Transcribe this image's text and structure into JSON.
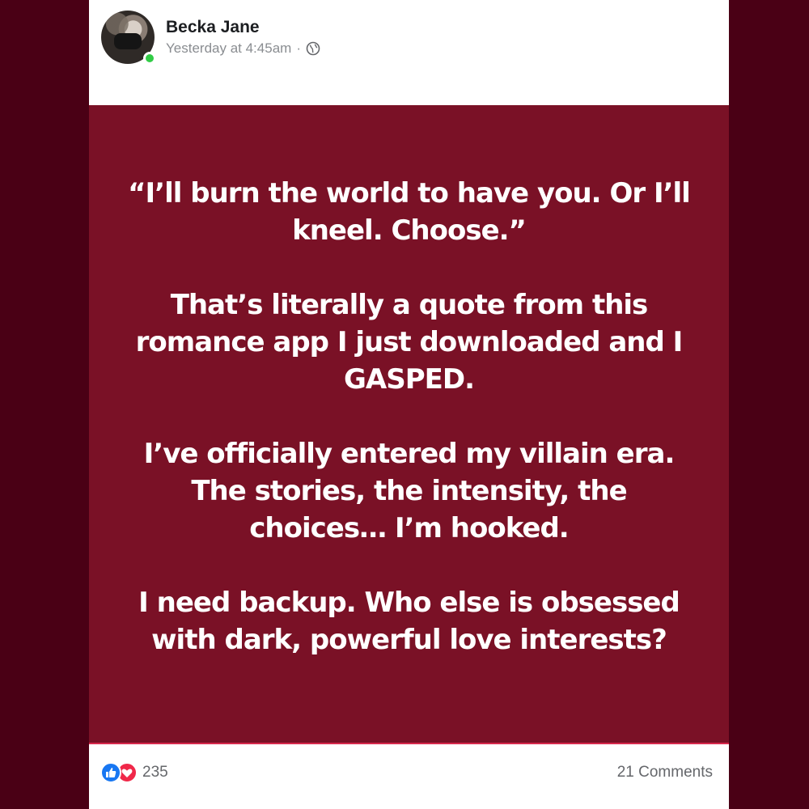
{
  "post": {
    "author": "Becka Jane",
    "timestamp": "Yesterday at 4:45am",
    "separator": "·",
    "privacy_icon": "globe-icon",
    "paragraphs": [
      "“I’ll burn the world to have you. Or I’ll kneel. Choose.”",
      "That’s literally a quote from this romance app I just downloaded and I GASPED.",
      "I’ve officially entered my villain era. The stories, the intensity, the choices… I’m hooked.",
      "I need backup. Who else is obsessed with dark, powerful love interests?"
    ],
    "background_color": "#7a1126"
  },
  "footer": {
    "reaction_icons": [
      "like-icon",
      "heart-icon"
    ],
    "reaction_count": "235",
    "comments": "21 Comments"
  },
  "colors": {
    "page_border": "#4a0015",
    "online": "#31cc46",
    "like": "#1877f2",
    "heart": "#f02849"
  }
}
